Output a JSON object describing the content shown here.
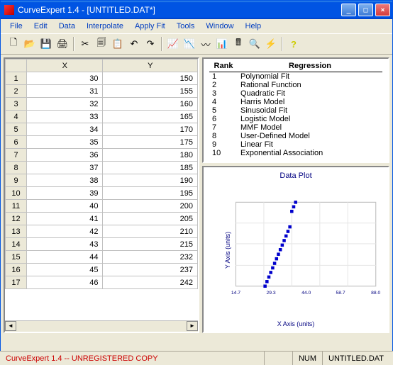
{
  "window": {
    "title": "CurveExpert 1.4 - [UNTITLED.DAT*]"
  },
  "menu": {
    "file": "File",
    "edit": "Edit",
    "data": "Data",
    "interpolate": "Interpolate",
    "applyfit": "Apply Fit",
    "tools": "Tools",
    "window": "Window",
    "help": "Help"
  },
  "table": {
    "header_x": "X",
    "header_y": "Y",
    "rows": [
      {
        "n": "1",
        "x": "30",
        "y": "150"
      },
      {
        "n": "2",
        "x": "31",
        "y": "155"
      },
      {
        "n": "3",
        "x": "32",
        "y": "160"
      },
      {
        "n": "4",
        "x": "33",
        "y": "165"
      },
      {
        "n": "5",
        "x": "34",
        "y": "170"
      },
      {
        "n": "6",
        "x": "35",
        "y": "175"
      },
      {
        "n": "7",
        "x": "36",
        "y": "180"
      },
      {
        "n": "8",
        "x": "37",
        "y": "185"
      },
      {
        "n": "9",
        "x": "38",
        "y": "190"
      },
      {
        "n": "10",
        "x": "39",
        "y": "195"
      },
      {
        "n": "11",
        "x": "40",
        "y": "200"
      },
      {
        "n": "12",
        "x": "41",
        "y": "205"
      },
      {
        "n": "13",
        "x": "42",
        "y": "210"
      },
      {
        "n": "14",
        "x": "43",
        "y": "215"
      },
      {
        "n": "15",
        "x": "44",
        "y": "232"
      },
      {
        "n": "16",
        "x": "45",
        "y": "237"
      },
      {
        "n": "17",
        "x": "46",
        "y": "242"
      }
    ]
  },
  "rank": {
    "col_rank": "Rank",
    "col_reg": "Regression",
    "items": [
      {
        "r": "1",
        "name": "Polynomial Fit"
      },
      {
        "r": "2",
        "name": "Rational Function"
      },
      {
        "r": "3",
        "name": "Quadratic Fit"
      },
      {
        "r": "4",
        "name": "Harris Model"
      },
      {
        "r": "5",
        "name": "Sinusoidal Fit"
      },
      {
        "r": "6",
        "name": "Logistic Model"
      },
      {
        "r": "7",
        "name": "MMF Model"
      },
      {
        "r": "8",
        "name": "User-Defined Model"
      },
      {
        "r": "9",
        "name": "Linear Fit"
      },
      {
        "r": "10",
        "name": "Exponential Association"
      }
    ]
  },
  "plot": {
    "title": "Data Plot",
    "xlabel": "X Axis (units)",
    "ylabel": "Y Axis (units)"
  },
  "chart_data": {
    "type": "scatter",
    "title": "Data Plot",
    "xlabel": "X Axis (units)",
    "ylabel": "Y Axis (units)",
    "xlim": [
      14.7,
      88.0
    ],
    "x": [
      30,
      31,
      32,
      33,
      34,
      35,
      36,
      37,
      38,
      39,
      40,
      41,
      42,
      43,
      44,
      45,
      46
    ],
    "y": [
      150,
      155,
      160,
      165,
      170,
      175,
      180,
      185,
      190,
      195,
      200,
      205,
      210,
      215,
      232,
      237,
      242
    ]
  },
  "status": {
    "left": "CurveExpert 1.4 -- UNREGISTERED COPY",
    "num": "NUM",
    "file": "UNTITLED.DAT"
  }
}
